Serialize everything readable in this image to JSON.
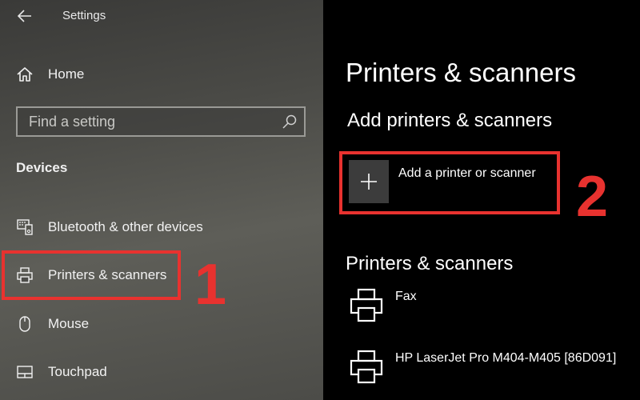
{
  "window": {
    "title": "Settings"
  },
  "nav": {
    "home_label": "Home",
    "search_placeholder": "Find a setting",
    "section_heading": "Devices",
    "items": [
      {
        "label": "Bluetooth & other devices",
        "icon": "bluetooth-devices-icon"
      },
      {
        "label": "Printers & scanners",
        "icon": "printer-icon"
      },
      {
        "label": "Mouse",
        "icon": "mouse-icon"
      },
      {
        "label": "Touchpad",
        "icon": "touchpad-icon"
      }
    ]
  },
  "main": {
    "title": "Printers & scanners",
    "add_section_heading": "Add printers & scanners",
    "add_button_label": "Add a printer or scanner",
    "list_heading": "Printers & scanners",
    "printers": [
      {
        "name": "Fax"
      },
      {
        "name": "HP LaserJet Pro M404-M405 [86D091]"
      }
    ]
  },
  "annotations": {
    "step_1": "1",
    "step_2": "2",
    "highlight_color": "#e8322f"
  }
}
